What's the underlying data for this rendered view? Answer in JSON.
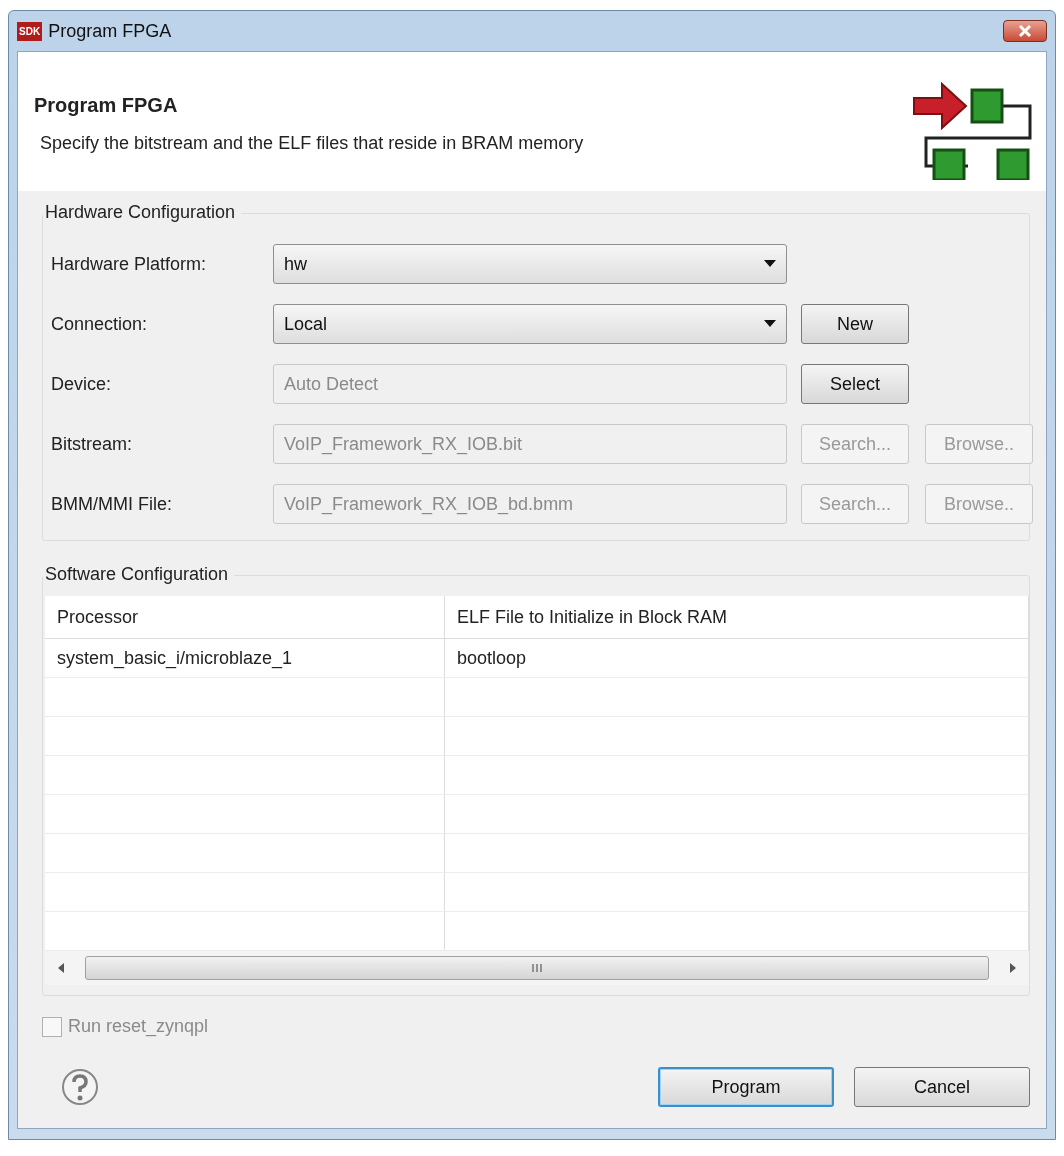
{
  "window": {
    "icon_text": "SDK",
    "title": "Program FPGA"
  },
  "header": {
    "title": "Program FPGA",
    "description": "Specify the bitstream and the ELF files that reside in BRAM memory"
  },
  "hardware": {
    "title": "Hardware Configuration",
    "fields": [
      {
        "label": "Hardware Platform:",
        "kind": "dropdown",
        "value": "hw",
        "disabled": false
      },
      {
        "label": "Connection:",
        "kind": "dropdown",
        "value": "Local",
        "disabled": false,
        "buttons": [
          {
            "label": "New",
            "disabled": false
          }
        ]
      },
      {
        "label": "Device:",
        "kind": "text",
        "value": "Auto Detect",
        "disabled": true,
        "buttons": [
          {
            "label": "Select",
            "disabled": false
          }
        ]
      },
      {
        "label": "Bitstream:",
        "kind": "text",
        "value": "VoIP_Framework_RX_IOB.bit",
        "disabled": true,
        "buttons": [
          {
            "label": "Search...",
            "disabled": true
          },
          {
            "label": "Browse..",
            "disabled": true
          }
        ]
      },
      {
        "label": "BMM/MMI File:",
        "kind": "text",
        "value": "VoIP_Framework_RX_IOB_bd.bmm",
        "disabled": true,
        "buttons": [
          {
            "label": "Search...",
            "disabled": true
          },
          {
            "label": "Browse..",
            "disabled": true
          }
        ]
      }
    ]
  },
  "software": {
    "title": "Software Configuration",
    "table": {
      "columns": [
        "Processor",
        "ELF File to Initialize in Block RAM"
      ],
      "rows": [
        [
          "system_basic_i/microblaze_1",
          "bootloop"
        ]
      ]
    }
  },
  "checkbox": {
    "label": "Run reset_zynqpl",
    "checked": false,
    "disabled": true
  },
  "buttons": [
    {
      "label": "Program",
      "default": true
    },
    {
      "label": "Cancel",
      "default": false
    }
  ]
}
